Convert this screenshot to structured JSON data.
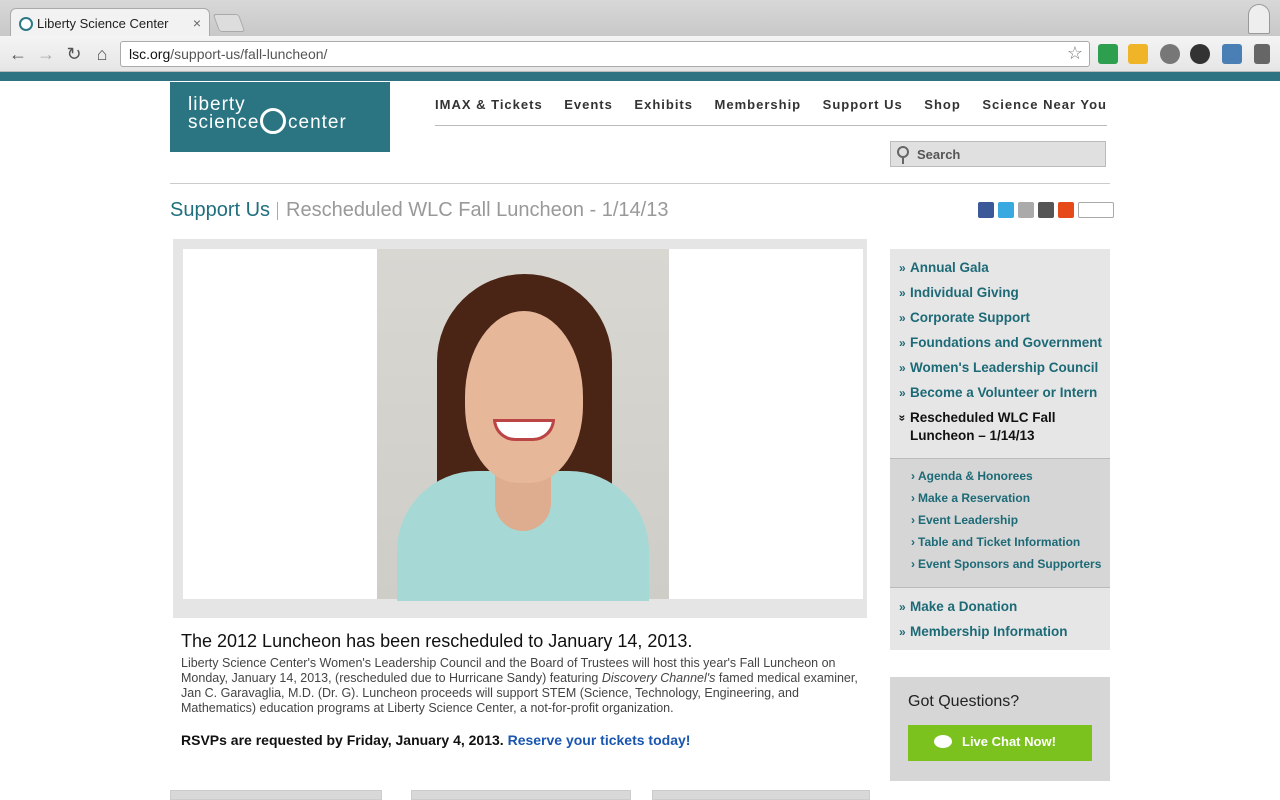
{
  "browser": {
    "tab_title": "Liberty Science Center",
    "tab_close": "×",
    "url_host": "lsc.org",
    "url_path": "/support-us/fall-luncheon/"
  },
  "logo": {
    "line1": "liberty",
    "line2": "science",
    "line3": "center"
  },
  "nav": [
    "IMAX & Tickets",
    "Events",
    "Exhibits",
    "Membership",
    "Support Us",
    "Shop",
    "Science Near You"
  ],
  "search": {
    "placeholder": "Search"
  },
  "breadcrumb": {
    "section": "Support Us",
    "page": "Rescheduled WLC Fall Luncheon - 1/14/13"
  },
  "share": {
    "colors": [
      "#3b5998",
      "#3aa9e0",
      "#aaaaaa",
      "#555555",
      "#e64a19"
    ]
  },
  "article": {
    "headline": "The 2012 Luncheon has been rescheduled to January 14, 2013.",
    "body_1": "Liberty Science Center's Women's Leadership Council and the Board of Trustees will host this year's Fall Luncheon on Monday, January 14, 2013, (rescheduled due to Hurricane Sandy) featuring ",
    "body_em": "Discovery Channel's",
    "body_2": " famed medical examiner, Jan C. Garavaglia, M.D. (Dr. G). Luncheon proceeds will support STEM (Science, Technology, Engineering, and Mathematics) education programs at Liberty Science Center, a not-for-profit organization.",
    "rsvp": "RSVPs are requested by Friday, January 4, 2013.",
    "rsvp_link": "Reserve your tickets today!"
  },
  "sidebar": {
    "items": [
      "Annual Gala",
      "Individual Giving",
      "Corporate Support",
      "Foundations and Government",
      "Women's Leadership Council",
      "Become a Volunteer or Intern"
    ],
    "current": "Rescheduled WLC Fall Luncheon – 1/14/13",
    "subitems": [
      "Agenda & Honorees",
      "Make a Reservation",
      "Event Leadership",
      "Table and Ticket Information",
      "Event Sponsors and Supporters"
    ],
    "items_after": [
      "Make a Donation",
      "Membership Information"
    ],
    "chevron": "»",
    "current_chevron": "»",
    "sub_chevron": "›"
  },
  "questions": {
    "title": "Got Questions?",
    "chat_label": "Live Chat Now!"
  }
}
